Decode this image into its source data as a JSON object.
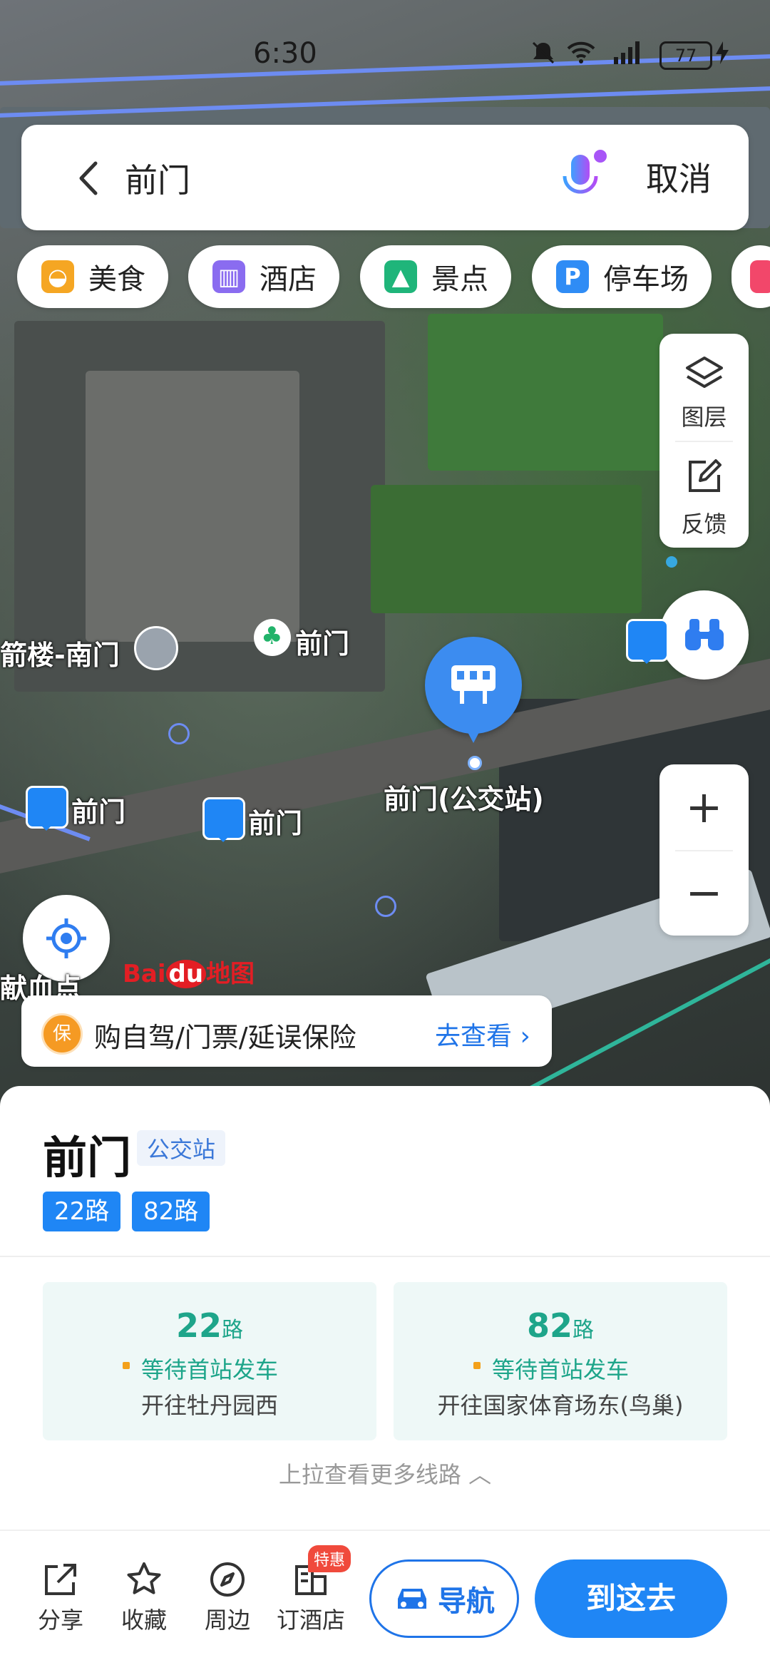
{
  "status_bar": {
    "time": "6:30",
    "battery": "77"
  },
  "search": {
    "query": "前门",
    "cancel_label": "取消"
  },
  "categories": [
    {
      "label": "美食",
      "icon": "food-icon",
      "color": "#f5a623"
    },
    {
      "label": "酒店",
      "icon": "hotel-icon",
      "color": "#8a6cf0"
    },
    {
      "label": "景点",
      "icon": "scenic-icon",
      "color": "#1fb57a"
    },
    {
      "label": "停车场",
      "icon": "parking-icon",
      "color": "#2f8cf5"
    }
  ],
  "tools": {
    "layers_label": "图层",
    "feedback_label": "反馈"
  },
  "map_labels": {
    "poi_south_gate": "箭楼-南门",
    "poi_qianmen_park": "前门",
    "bus_stop_left": "前门",
    "bus_stop_center": "前门",
    "selected_stop": "前门(公交站)",
    "blood_donation": "献血点"
  },
  "logo": {
    "brand_a": "Bai",
    "brand_b": "du",
    "brand_c": "地图"
  },
  "insurance": {
    "text": "购自驾/门票/延误保险",
    "link": "去查看"
  },
  "stop": {
    "name": "前门",
    "type": "公交站",
    "routes": [
      "22路",
      "82路"
    ]
  },
  "route_cards": [
    {
      "number": "22",
      "suffix": "路",
      "status": "等待首站发车",
      "destination": "开往牡丹园西"
    },
    {
      "number": "82",
      "suffix": "路",
      "status": "等待首站发车",
      "destination": "开往国家体育场东(鸟巢)"
    }
  ],
  "more_routes": "上拉查看更多线路",
  "actions": {
    "share": "分享",
    "favorite": "收藏",
    "nearby": "周边",
    "book_hotel": "订酒店",
    "hotel_badge": "特惠",
    "navigate": "导航",
    "go_here": "到这去"
  },
  "colors": {
    "accent": "#1f86f5",
    "route_green": "#1ea58a"
  }
}
